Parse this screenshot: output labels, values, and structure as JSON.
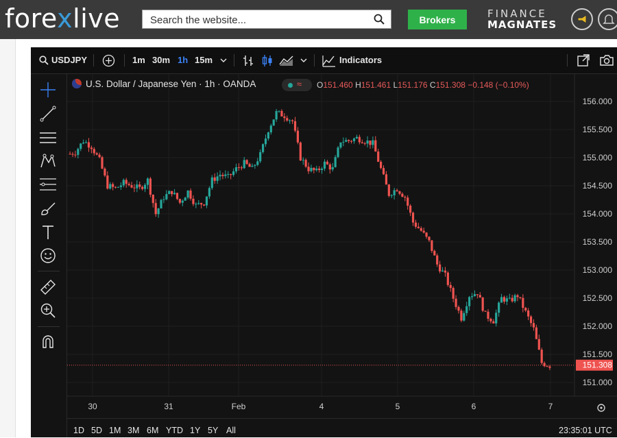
{
  "header": {
    "logo_pre": "fore",
    "logo_x": "x",
    "logo_post": "live",
    "search_placeholder": "Search the website...",
    "brokers_label": "Brokers",
    "partner_line1": "FINANCE",
    "partner_line2": "MAGNATES",
    "icons": [
      "search-icon",
      "megaphone-icon",
      "bell-icon"
    ]
  },
  "toolbar": {
    "symbol": "USDJPY",
    "intervals": [
      "1m",
      "30m",
      "1h",
      "15m"
    ],
    "active_interval": "1h",
    "indicators_label": "Indicators"
  },
  "legend": {
    "title": "U.S. Dollar / Japanese Yen · 1h · OANDA",
    "o_label": "O",
    "o": "151.460",
    "h_label": "H",
    "h": "151.461",
    "l_label": "L",
    "l": "151.176",
    "c_label": "C",
    "c": "151.308",
    "change": "−0.148 (−0.10%)"
  },
  "chart_data": {
    "type": "candlestick",
    "symbol": "USDJPY",
    "ylim": [
      150.7,
      156.2
    ],
    "y_ticks": [
      "156.000",
      "155.500",
      "155.000",
      "154.500",
      "154.000",
      "153.500",
      "153.000",
      "152.500",
      "152.000",
      "151.500",
      "151.000"
    ],
    "x_ticks": [
      "30",
      "31",
      "Feb",
      "4",
      "5",
      "6",
      "7"
    ],
    "last_price": "151.308",
    "up_color": "#26a69a",
    "down_color": "#ef5350",
    "closes": [
      155.1,
      155.3,
      155.2,
      154.95,
      154.5,
      154.45,
      154.55,
      154.5,
      154.45,
      154.6,
      154.0,
      154.3,
      154.4,
      154.2,
      154.4,
      154.15,
      154.2,
      154.6,
      154.7,
      154.65,
      154.8,
      154.9,
      154.8,
      155.05,
      155.5,
      155.8,
      155.75,
      155.65,
      155.0,
      154.8,
      154.75,
      154.9,
      154.8,
      155.3,
      155.3,
      155.35,
      155.3,
      155.25,
      154.8,
      154.35,
      154.45,
      154.3,
      153.85,
      153.7,
      153.5,
      153.1,
      152.9,
      152.5,
      152.15,
      152.55,
      152.6,
      152.2,
      152.1,
      152.5,
      152.45,
      152.55,
      152.25,
      151.95,
      151.35,
      151.3
    ]
  },
  "timebar": {
    "ranges": [
      "1D",
      "5D",
      "1M",
      "3M",
      "6M",
      "YTD",
      "1Y",
      "5Y",
      "All"
    ],
    "clock": "23:35:01 UTC"
  }
}
